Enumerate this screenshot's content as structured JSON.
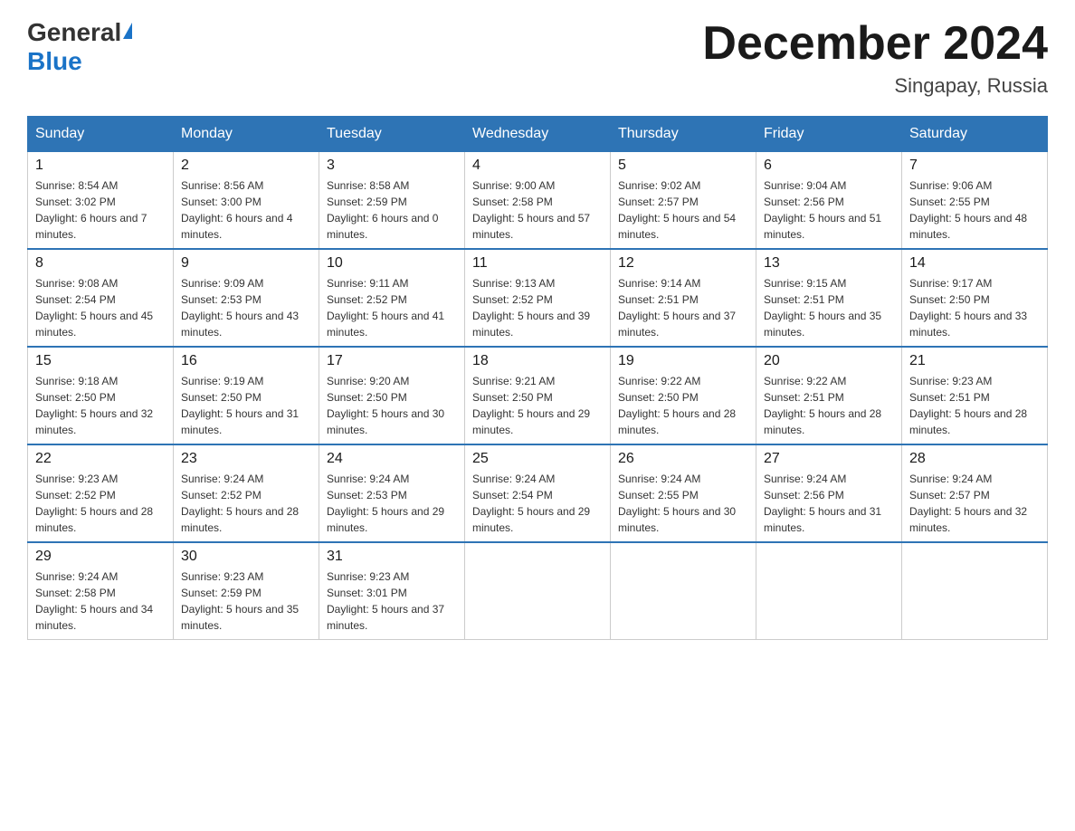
{
  "header": {
    "logo_general": "General",
    "logo_blue": "Blue",
    "month_title": "December 2024",
    "location": "Singapay, Russia"
  },
  "days_of_week": [
    "Sunday",
    "Monday",
    "Tuesday",
    "Wednesday",
    "Thursday",
    "Friday",
    "Saturday"
  ],
  "weeks": [
    [
      {
        "day": "1",
        "sunrise": "8:54 AM",
        "sunset": "3:02 PM",
        "daylight": "6 hours and 7 minutes."
      },
      {
        "day": "2",
        "sunrise": "8:56 AM",
        "sunset": "3:00 PM",
        "daylight": "6 hours and 4 minutes."
      },
      {
        "day": "3",
        "sunrise": "8:58 AM",
        "sunset": "2:59 PM",
        "daylight": "6 hours and 0 minutes."
      },
      {
        "day": "4",
        "sunrise": "9:00 AM",
        "sunset": "2:58 PM",
        "daylight": "5 hours and 57 minutes."
      },
      {
        "day": "5",
        "sunrise": "9:02 AM",
        "sunset": "2:57 PM",
        "daylight": "5 hours and 54 minutes."
      },
      {
        "day": "6",
        "sunrise": "9:04 AM",
        "sunset": "2:56 PM",
        "daylight": "5 hours and 51 minutes."
      },
      {
        "day": "7",
        "sunrise": "9:06 AM",
        "sunset": "2:55 PM",
        "daylight": "5 hours and 48 minutes."
      }
    ],
    [
      {
        "day": "8",
        "sunrise": "9:08 AM",
        "sunset": "2:54 PM",
        "daylight": "5 hours and 45 minutes."
      },
      {
        "day": "9",
        "sunrise": "9:09 AM",
        "sunset": "2:53 PM",
        "daylight": "5 hours and 43 minutes."
      },
      {
        "day": "10",
        "sunrise": "9:11 AM",
        "sunset": "2:52 PM",
        "daylight": "5 hours and 41 minutes."
      },
      {
        "day": "11",
        "sunrise": "9:13 AM",
        "sunset": "2:52 PM",
        "daylight": "5 hours and 39 minutes."
      },
      {
        "day": "12",
        "sunrise": "9:14 AM",
        "sunset": "2:51 PM",
        "daylight": "5 hours and 37 minutes."
      },
      {
        "day": "13",
        "sunrise": "9:15 AM",
        "sunset": "2:51 PM",
        "daylight": "5 hours and 35 minutes."
      },
      {
        "day": "14",
        "sunrise": "9:17 AM",
        "sunset": "2:50 PM",
        "daylight": "5 hours and 33 minutes."
      }
    ],
    [
      {
        "day": "15",
        "sunrise": "9:18 AM",
        "sunset": "2:50 PM",
        "daylight": "5 hours and 32 minutes."
      },
      {
        "day": "16",
        "sunrise": "9:19 AM",
        "sunset": "2:50 PM",
        "daylight": "5 hours and 31 minutes."
      },
      {
        "day": "17",
        "sunrise": "9:20 AM",
        "sunset": "2:50 PM",
        "daylight": "5 hours and 30 minutes."
      },
      {
        "day": "18",
        "sunrise": "9:21 AM",
        "sunset": "2:50 PM",
        "daylight": "5 hours and 29 minutes."
      },
      {
        "day": "19",
        "sunrise": "9:22 AM",
        "sunset": "2:50 PM",
        "daylight": "5 hours and 28 minutes."
      },
      {
        "day": "20",
        "sunrise": "9:22 AM",
        "sunset": "2:51 PM",
        "daylight": "5 hours and 28 minutes."
      },
      {
        "day": "21",
        "sunrise": "9:23 AM",
        "sunset": "2:51 PM",
        "daylight": "5 hours and 28 minutes."
      }
    ],
    [
      {
        "day": "22",
        "sunrise": "9:23 AM",
        "sunset": "2:52 PM",
        "daylight": "5 hours and 28 minutes."
      },
      {
        "day": "23",
        "sunrise": "9:24 AM",
        "sunset": "2:52 PM",
        "daylight": "5 hours and 28 minutes."
      },
      {
        "day": "24",
        "sunrise": "9:24 AM",
        "sunset": "2:53 PM",
        "daylight": "5 hours and 29 minutes."
      },
      {
        "day": "25",
        "sunrise": "9:24 AM",
        "sunset": "2:54 PM",
        "daylight": "5 hours and 29 minutes."
      },
      {
        "day": "26",
        "sunrise": "9:24 AM",
        "sunset": "2:55 PM",
        "daylight": "5 hours and 30 minutes."
      },
      {
        "day": "27",
        "sunrise": "9:24 AM",
        "sunset": "2:56 PM",
        "daylight": "5 hours and 31 minutes."
      },
      {
        "day": "28",
        "sunrise": "9:24 AM",
        "sunset": "2:57 PM",
        "daylight": "5 hours and 32 minutes."
      }
    ],
    [
      {
        "day": "29",
        "sunrise": "9:24 AM",
        "sunset": "2:58 PM",
        "daylight": "5 hours and 34 minutes."
      },
      {
        "day": "30",
        "sunrise": "9:23 AM",
        "sunset": "2:59 PM",
        "daylight": "5 hours and 35 minutes."
      },
      {
        "day": "31",
        "sunrise": "9:23 AM",
        "sunset": "3:01 PM",
        "daylight": "5 hours and 37 minutes."
      },
      null,
      null,
      null,
      null
    ]
  ]
}
